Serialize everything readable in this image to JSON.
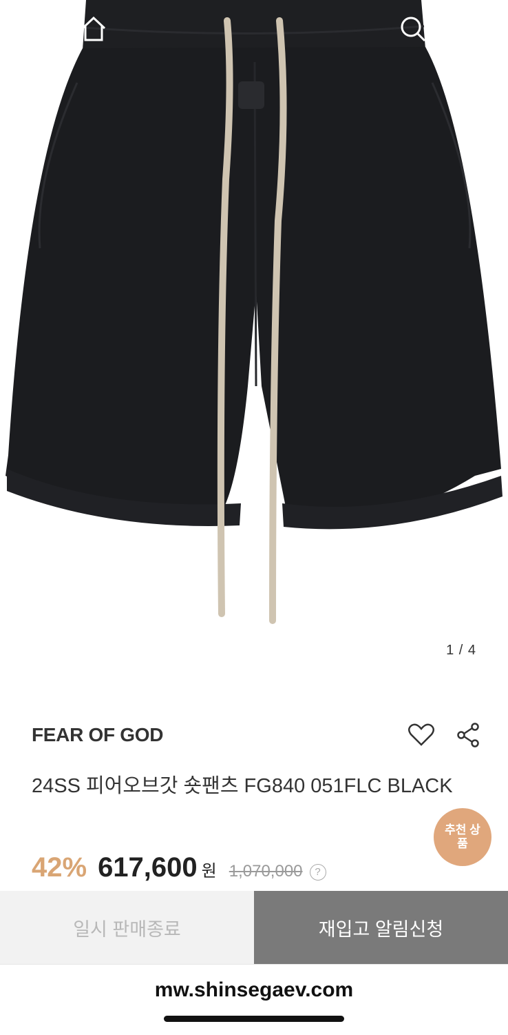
{
  "gallery": {
    "counter": "1 / 4"
  },
  "header": {
    "icons": {
      "back": "back-chevron-icon",
      "home": "home-icon",
      "search": "search-icon",
      "cart": "shopping-bag-icon"
    }
  },
  "product": {
    "brand": "FEAR OF GOD",
    "title": "24SS 피어오브갓 숏팬츠 FG840 051FLC BLACK",
    "recommend_badge": "추천 상품",
    "discount": "42%",
    "sale_price": "617,600",
    "currency": "원",
    "original_price": "1,070,000",
    "help_symbol": "?"
  },
  "actions": {
    "sold_out_label": "일시 판매종료",
    "restock_label": "재입고 알림신청"
  },
  "browser": {
    "url": "mw.shinsegaev.com"
  },
  "colors": {
    "accent": "#d9a574",
    "badge": "#e0a77c",
    "button_dark": "#7a7a7a"
  }
}
